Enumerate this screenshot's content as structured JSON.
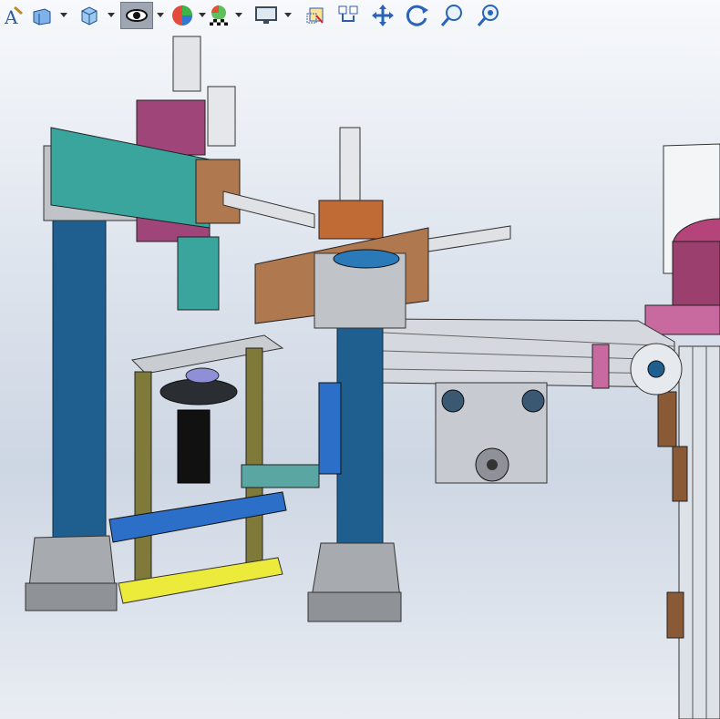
{
  "viewport": {
    "background": [
      "#f7f9fc",
      "#cdd6e3"
    ]
  },
  "toolbar": {
    "items": [
      {
        "name": "annotation-icon",
        "dropdown": false
      },
      {
        "name": "section-view-icon",
        "dropdown": true
      },
      {
        "name": "display-style-icon",
        "dropdown": true
      },
      {
        "name": "hide-show-items-icon",
        "dropdown": true,
        "active": true
      },
      {
        "name": "edit-appearance-icon",
        "dropdown": true
      },
      {
        "name": "apply-scene-icon",
        "dropdown": true
      },
      {
        "name": "view-settings-icon",
        "dropdown": true
      },
      {
        "name": "zoom-to-fit-icon",
        "dropdown": false
      },
      {
        "name": "zoom-to-area-icon",
        "dropdown": false
      },
      {
        "name": "pan-icon",
        "dropdown": false
      },
      {
        "name": "rotate-view-icon",
        "dropdown": false
      },
      {
        "name": "zoom-in-out-icon",
        "dropdown": false
      },
      {
        "name": "zoom-to-selection-icon",
        "dropdown": false
      }
    ]
  },
  "colors": {
    "column": "#1f5f8f",
    "block_gray": "#bfc2c6",
    "magenta": "#a0457a",
    "teal": "#3aa59d",
    "copper": "#b0784e",
    "yellow_plate": "#ecea3a",
    "olive": "#7f7a3a",
    "conveyor": "#c8ccd2"
  }
}
